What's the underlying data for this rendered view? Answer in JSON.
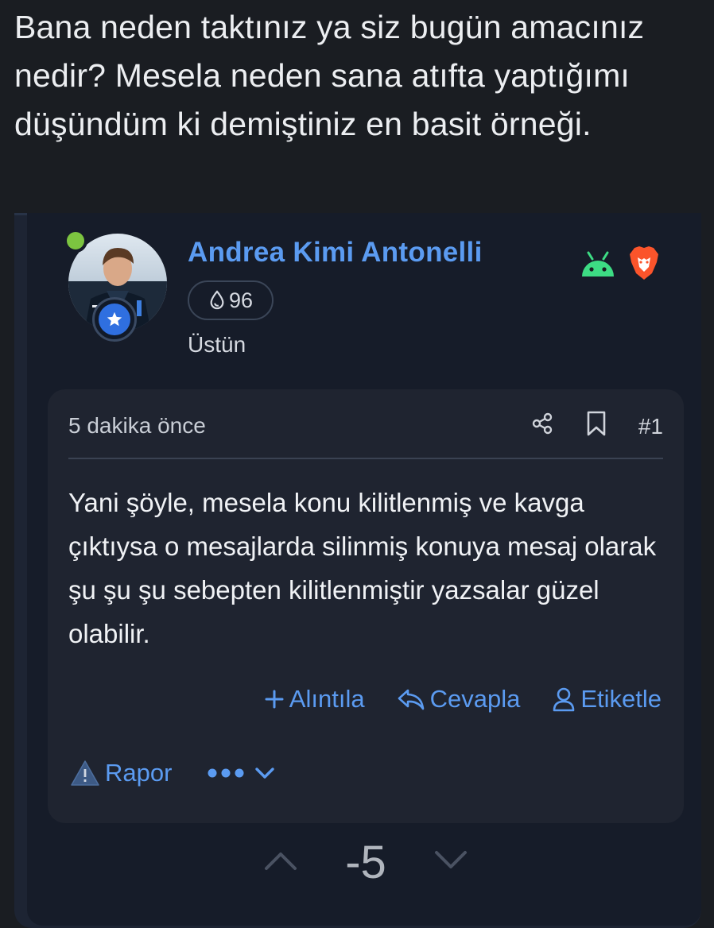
{
  "quoted_message": "Bana neden taktınız ya siz bugün amacınız nedir? Mesela neden sana atıfta yaptığımı düşündüm ki demiştiniz en basit örneği.",
  "author": {
    "name": "Andrea Kimi Antonelli",
    "points": "96",
    "title": "Üstün",
    "online": true,
    "platforms": [
      "android-icon",
      "brave-browser-icon"
    ]
  },
  "post": {
    "timestamp": "5 dakika önce",
    "number": "#1",
    "content": "Yani şöyle, mesela konu kilitlenmiş ve kavga çıktıysa o mesajlarda silinmiş konuya mesaj olarak şu şu şu sebepten kilitlenmiştir yazsalar güzel olabilir."
  },
  "actions": {
    "quote": "Alıntıla",
    "reply": "Cevapla",
    "tag": "Etiketle",
    "report": "Rapor"
  },
  "votes": {
    "count": "-5"
  },
  "colors": {
    "accent": "#5b9bf1",
    "online": "#7cc440",
    "android": "#3ddc84",
    "brave": "#fb542b"
  }
}
